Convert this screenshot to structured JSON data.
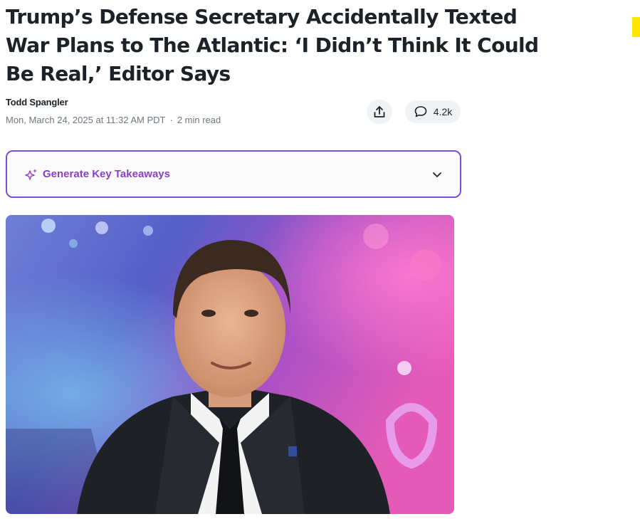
{
  "article": {
    "headline": "Trump’s Defense Secretary Accidentally Texted War Plans to The Atlantic: ‘I Didn’t Think It Could Be Real,’ Editor Says",
    "author": "Todd Spangler",
    "date": "Mon, March 24, 2025 at 11:32 AM PDT",
    "separator": "·",
    "read_time": "2 min read"
  },
  "actions": {
    "share_icon": "share-icon",
    "comment_icon": "comment-icon",
    "comment_count": "4.2k"
  },
  "takeaways": {
    "label": "Generate Key Takeaways",
    "icon": "sparkle-icon",
    "chevron": "chevron-down-icon"
  },
  "colors": {
    "accent_purple": "#8a3fc7",
    "border_purple": "#7b4ed8",
    "marker_yellow": "#ffe600"
  }
}
